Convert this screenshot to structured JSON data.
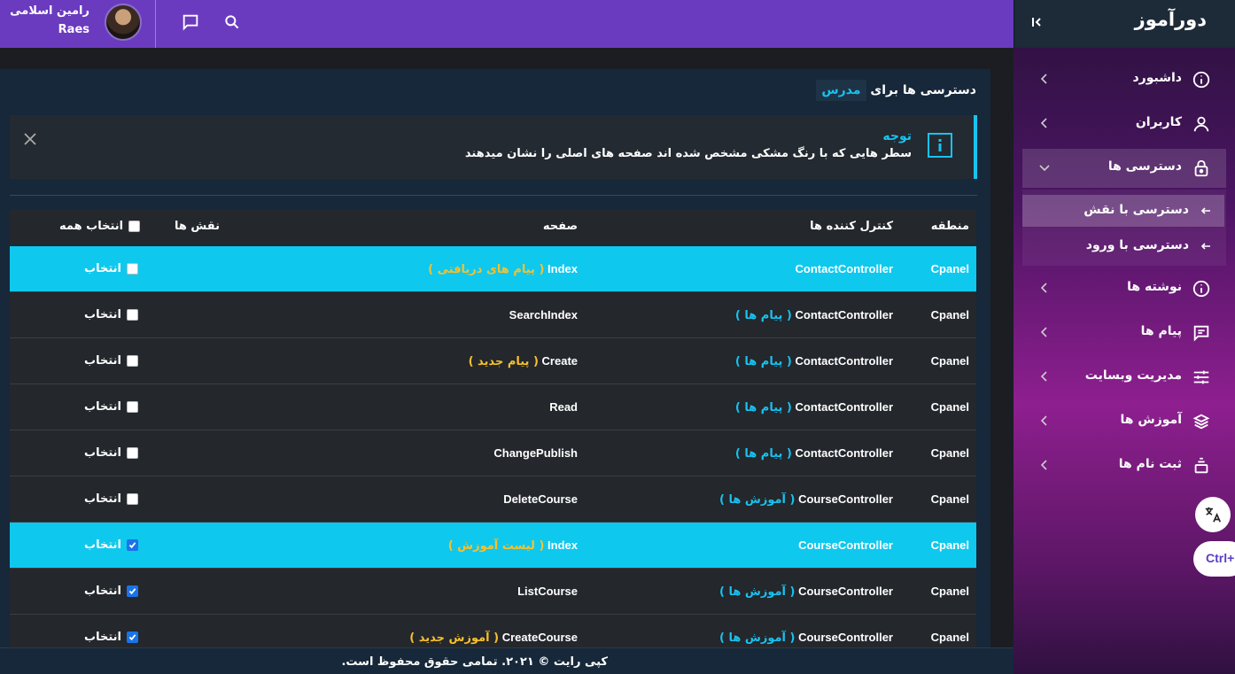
{
  "header": {
    "user_name": "رامین اسلامی",
    "user_role": "Raes",
    "icons": [
      "chat-icon",
      "search-icon"
    ]
  },
  "sidebar": {
    "brand": "دورآموز",
    "items": [
      {
        "label": "داشبورد",
        "icon": "info-icon"
      },
      {
        "label": "کاربران",
        "icon": "user-icon"
      },
      {
        "label": "دسترسی ها",
        "icon": "lock-icon"
      },
      {
        "label": "نوشته ها",
        "icon": "info-icon"
      },
      {
        "label": "پیام ها",
        "icon": "message-icon"
      },
      {
        "label": "مدیریت وبسایت",
        "icon": "sliders-icon"
      },
      {
        "label": "آموزش ها",
        "icon": "layers-icon"
      },
      {
        "label": "ثبت نام ها",
        "icon": "register-icon"
      }
    ],
    "submenu": [
      {
        "label": "دسترسی با نقش"
      },
      {
        "label": "دسترسی با ورود"
      }
    ],
    "ctrl_label": "Ctrl+"
  },
  "panel": {
    "title_prefix": "دسترسی ها برای",
    "role": "مدرس",
    "alert_title": "توجه",
    "alert_text": "سطر هایی که با رنگ مشکی مشخص شده اند صفحه های اصلی را نشان میدهند"
  },
  "table": {
    "headers": {
      "region": "منطقه",
      "controller": "کنترل کننده ها",
      "page": "صفحه",
      "roles": "نقش ها",
      "select_all": "انتخاب همه"
    },
    "select_label": "انتخاب",
    "rows": [
      {
        "region": "Cpanel",
        "controller": "ContactController",
        "controller_tag": "",
        "page": "Index",
        "page_tag": "( پیام های دریافتی )",
        "highlight": true,
        "checked": false
      },
      {
        "region": "Cpanel",
        "controller": "ContactController",
        "controller_tag": "( پیام ها )",
        "page": "SearchIndex",
        "page_tag": "",
        "highlight": false,
        "checked": false
      },
      {
        "region": "Cpanel",
        "controller": "ContactController",
        "controller_tag": "( پیام ها )",
        "page": "Create",
        "page_tag": "( پیام جدید )",
        "highlight": false,
        "checked": false
      },
      {
        "region": "Cpanel",
        "controller": "ContactController",
        "controller_tag": "( پیام ها )",
        "page": "Read",
        "page_tag": "",
        "highlight": false,
        "checked": false
      },
      {
        "region": "Cpanel",
        "controller": "ContactController",
        "controller_tag": "( پیام ها )",
        "page": "ChangePublish",
        "page_tag": "",
        "highlight": false,
        "checked": false
      },
      {
        "region": "Cpanel",
        "controller": "CourseController",
        "controller_tag": "( آموزش ها )",
        "page": "DeleteCourse",
        "page_tag": "",
        "highlight": false,
        "checked": false
      },
      {
        "region": "Cpanel",
        "controller": "CourseController",
        "controller_tag": "",
        "page": "Index",
        "page_tag": "( لیست آموزش )",
        "highlight": true,
        "checked": true
      },
      {
        "region": "Cpanel",
        "controller": "CourseController",
        "controller_tag": "( آموزش ها )",
        "page": "ListCourse",
        "page_tag": "",
        "highlight": false,
        "checked": true
      },
      {
        "region": "Cpanel",
        "controller": "CourseController",
        "controller_tag": "( آموزش ها )",
        "page": "CreateCourse",
        "page_tag": "( آموزش جدید )",
        "highlight": false,
        "checked": true
      }
    ]
  },
  "footer": {
    "text": "کپی رایت © ۲۰۲۱. تمامی حقوق محفوظ است."
  }
}
